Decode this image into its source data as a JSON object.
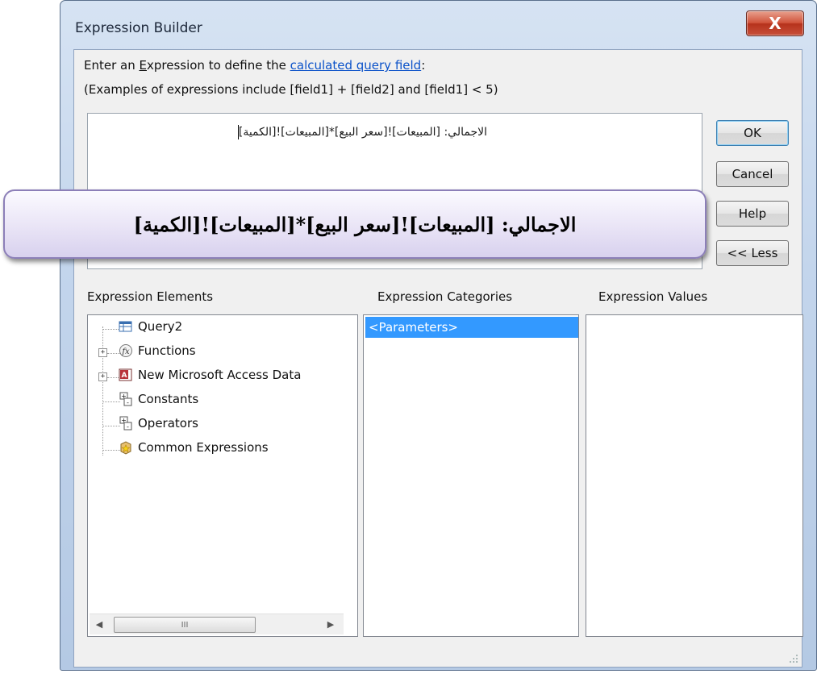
{
  "window": {
    "title": "Expression Builder",
    "close_glyph": "X"
  },
  "instructions": {
    "line1_pre": "Enter an ",
    "line1_accel": "E",
    "line1_mid": "xpression to define the ",
    "line1_link": "calculated query field",
    "line1_post": ":",
    "line2": "(Examples of expressions include [field1] + [field2] and [field1] < 5)"
  },
  "expression": {
    "value": "الاجمالي: [المبيعات]![سعر البيع]*[المبيعات]![الكمية]"
  },
  "callout": {
    "text": "الاجمالي: [المبيعات]![سعر البيع]*[المبيعات]![الكمية]"
  },
  "buttons": {
    "ok": "OK",
    "cancel": "Cancel",
    "help": "Help",
    "less": "<< Less"
  },
  "columns": {
    "elements": "Expression Elements",
    "categories": "Expression Categories",
    "values": "Expression Values"
  },
  "tree": [
    {
      "label": "Query2",
      "icon": "query-icon"
    },
    {
      "label": "Functions",
      "icon": "function-icon"
    },
    {
      "label": "New Microsoft Access Data",
      "icon": "access-db-icon"
    },
    {
      "label": "Constants",
      "icon": "constants-icon"
    },
    {
      "label": "Operators",
      "icon": "operators-icon"
    },
    {
      "label": "Common Expressions",
      "icon": "common-expressions-icon"
    }
  ],
  "scrollbar": {
    "grip": "III"
  },
  "categories": {
    "selected": "<Parameters>"
  },
  "colors": {
    "selection": "#3399ff",
    "link": "#0b52c9",
    "close": "#c7503a"
  }
}
